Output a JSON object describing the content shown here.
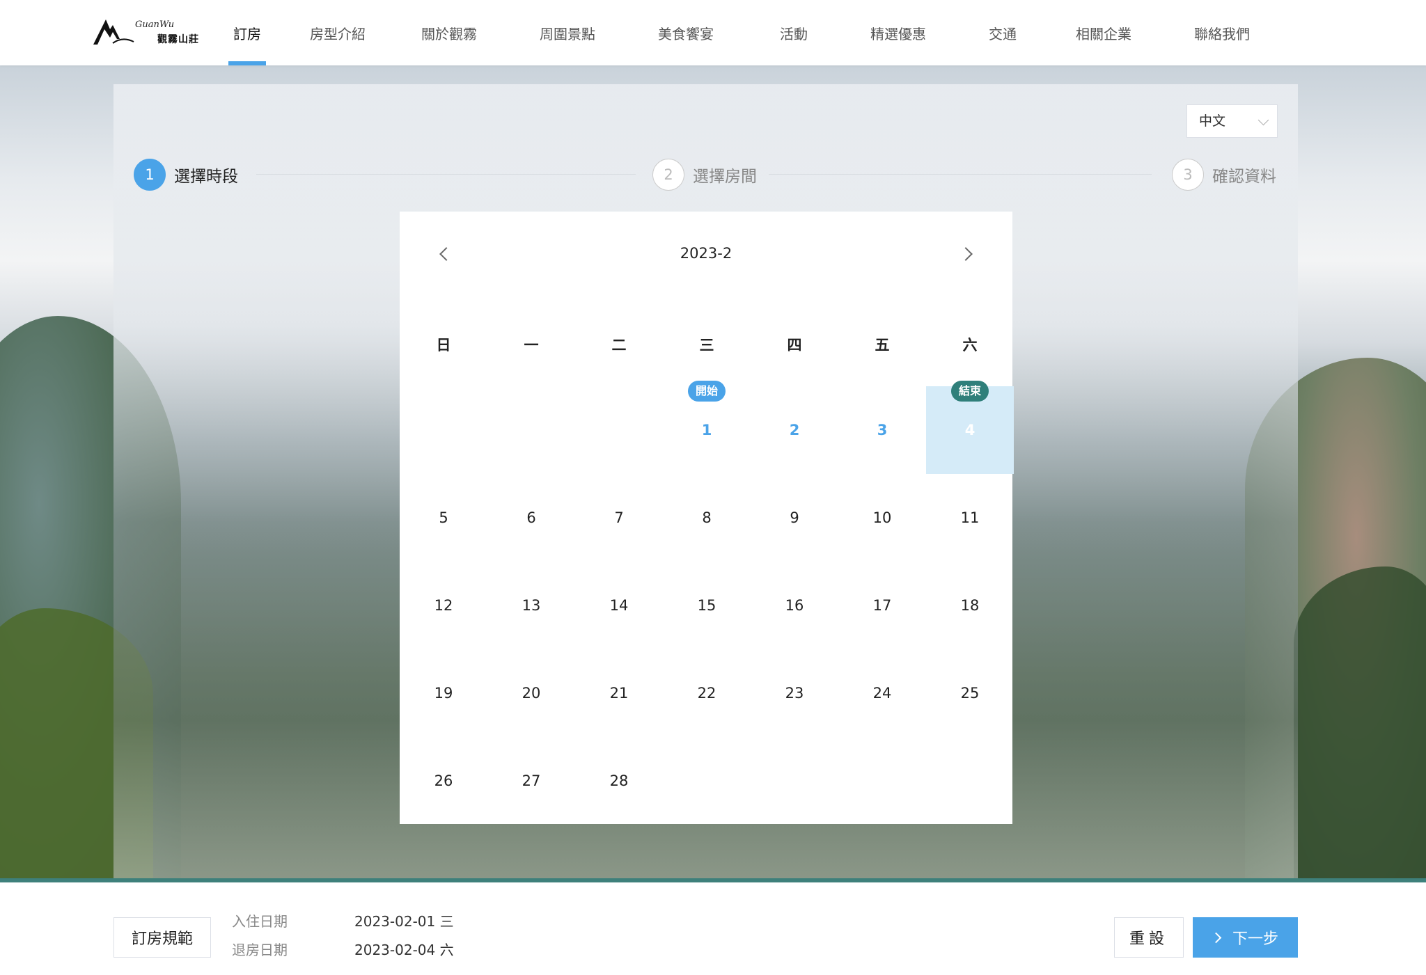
{
  "brand": {
    "name_en": "GuanWu",
    "name_cn": "觀霧山莊"
  },
  "nav": [
    {
      "label": "訂房",
      "active": true
    },
    {
      "label": "房型介紹"
    },
    {
      "label": "關於觀霧"
    },
    {
      "label": "周圍景點"
    },
    {
      "label": "美食饗宴"
    },
    {
      "label": "活動"
    },
    {
      "label": "精選優惠"
    },
    {
      "label": "交通"
    },
    {
      "label": "相關企業"
    },
    {
      "label": "聯絡我們"
    }
  ],
  "language": {
    "selected": "中文"
  },
  "steps": [
    {
      "num": "1",
      "label": "選擇時段",
      "active": true
    },
    {
      "num": "2",
      "label": "選擇房間"
    },
    {
      "num": "3",
      "label": "確認資料"
    }
  ],
  "calendar": {
    "title": "2023-2",
    "weekdays": [
      "日",
      "一",
      "二",
      "三",
      "四",
      "五",
      "六"
    ],
    "start_tag": "開始",
    "end_tag": "結束",
    "first_weekday_index": 3,
    "days_in_month": 28,
    "selected_start": 1,
    "selected_end": 4
  },
  "footer": {
    "rules_label": "訂房規範",
    "checkin_label": "入住日期",
    "checkin_value": "2023-02-01 三",
    "checkout_label": "退房日期",
    "checkout_value": "2023-02-04 六",
    "reset_label": "重設",
    "next_label": "下一步"
  },
  "colors": {
    "accent": "#4aa3e8",
    "end_tag": "#2f7f7a",
    "footer_border": "#3e807b",
    "range_bg": "#d5ebf8"
  }
}
